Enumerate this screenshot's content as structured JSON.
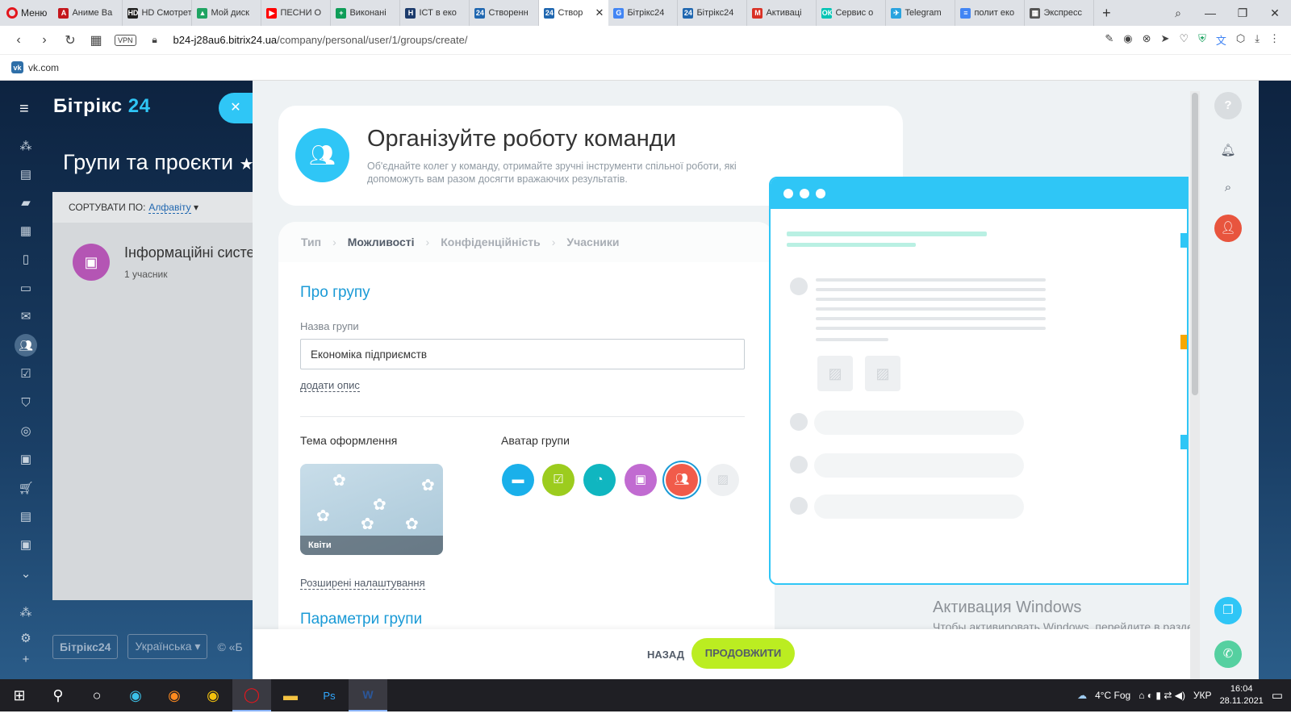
{
  "browser": {
    "menu_label": "Меню",
    "tabs": [
      {
        "label": "Аниме Ва",
        "fav": "А",
        "color": "#c4161c"
      },
      {
        "label": "HD Смотреть",
        "fav": "HD",
        "color": "#222222"
      },
      {
        "label": "Мой диск",
        "fav": "▲",
        "color": "#1fa463"
      },
      {
        "label": "ПЕСНИ О",
        "fav": "▶",
        "color": "#ff0000"
      },
      {
        "label": "Виконані",
        "fav": "+",
        "color": "#0f9d58"
      },
      {
        "label": "ІСТ в еко",
        "fav": "Н",
        "color": "#1b3a6b"
      },
      {
        "label": "Створенн",
        "fav": "24",
        "color": "#2067b0"
      },
      {
        "label": "Створ",
        "fav": "24",
        "color": "#2067b0",
        "active": true
      },
      {
        "label": "Бітрікс24",
        "fav": "G",
        "color": "#4285f4"
      },
      {
        "label": "Бітрікс24",
        "fav": "24",
        "color": "#2067b0"
      },
      {
        "label": "Активаці",
        "fav": "M",
        "color": "#d93025"
      },
      {
        "label": "Сервис о",
        "fav": "ОК",
        "color": "#00c4b4"
      },
      {
        "label": "Telegram",
        "fav": "✈",
        "color": "#2aa3df"
      },
      {
        "label": "полит еко",
        "fav": "≡",
        "color": "#4285f4"
      },
      {
        "label": "Экспресс",
        "fav": "▦",
        "color": "#555555"
      }
    ],
    "url_domain": "b24-j28au6.bitrix24.ua",
    "url_path": "/company/personal/user/1/groups/create/",
    "vpn_label": "VPN",
    "bookmark": "vk.com"
  },
  "bitrix": {
    "logo_text": "Бітрікс",
    "logo_num": "24",
    "page_title": "Групи та проєкти",
    "sort_label": "СОРТУВАТИ ПО:",
    "sort_value": "Алфавіту",
    "group_name": "Інформаційні системи",
    "group_count": "1 учасник",
    "footer_logo": "Бітрікс24",
    "footer_lang": "Українська",
    "footer_copy": "© «Б"
  },
  "slider": {
    "hero_title": "Організуйте роботу команди",
    "hero_sub": "Об'єднайте колег у команду, отримайте зручні інструменти спільної роботи, які допоможуть вам разом досягти вражаючих результатів.",
    "steps": [
      "Тип",
      "Можливості",
      "Конфіденційність",
      "Учасники"
    ],
    "current_step": 1,
    "section_about": "Про групу",
    "name_label": "Назва групи",
    "name_value": "Економіка підприємств",
    "add_description": "додати опис",
    "theme_label": "Тема оформлення",
    "theme_name": "Квіти",
    "avatar_label": "Аватар групи",
    "advanced_link": "Розширені налаштування",
    "section_params": "Параметри групи",
    "back_button": "НАЗАД",
    "next_button": "ПРОДОВЖИТИ"
  },
  "watermark": {
    "title": "Активация Windows",
    "text": "Чтобы активировать Windows, перейдите в раздел \"Параметры\"."
  },
  "taskbar": {
    "weather": "4°C  Fog",
    "lang": "УКР",
    "time": "16:04",
    "date": "28.11.2021"
  }
}
